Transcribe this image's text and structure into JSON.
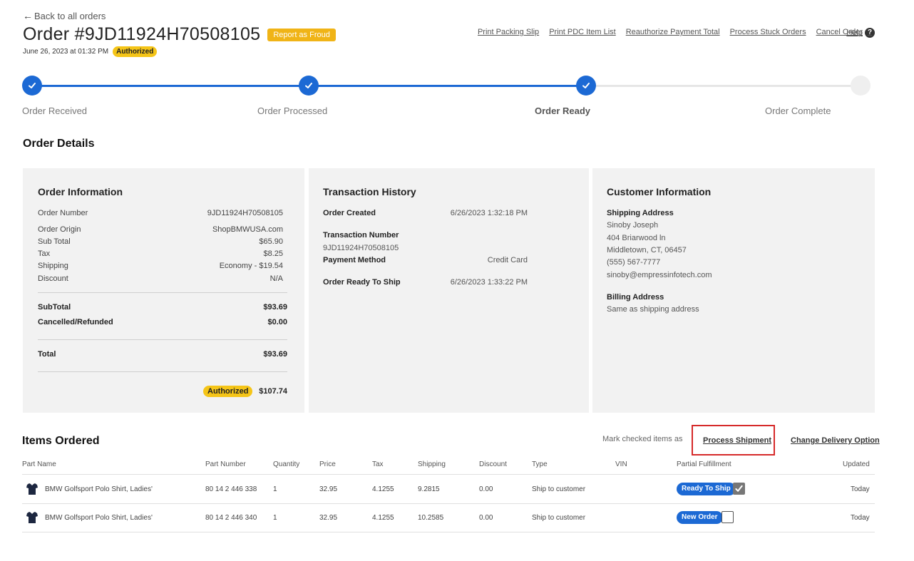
{
  "header": {
    "back_label": "Back to all orders",
    "order_title": "Order #9JD11924H70508105",
    "fraud_button": "Report as Froud",
    "date": "June 26, 2023 at 01:32 PM",
    "status_badge": "Authorized"
  },
  "actions": [
    "Print Packing Slip",
    "Print PDC Item List",
    "Reauthorize Payment Total",
    "Process Stuck Orders",
    "Cancel Order"
  ],
  "help_label": "Help",
  "progress": {
    "steps": [
      {
        "label": "Order Received",
        "state": "done"
      },
      {
        "label": "Order Processed",
        "state": "done"
      },
      {
        "label": "Order Ready",
        "state": "current"
      },
      {
        "label": "Order Complete",
        "state": "todo"
      }
    ]
  },
  "order_details_title": "Order Details",
  "order_info": {
    "title": "Order Information",
    "rows": [
      {
        "label": "Order Number",
        "value": "9JD11924H70508105"
      },
      {
        "label": "Order Origin",
        "value": "ShopBMWUSA.com"
      },
      {
        "label": "Sub Total",
        "value": "$65.90"
      },
      {
        "label": "Tax",
        "value": "$8.25"
      },
      {
        "label": "Shipping",
        "value": "Economy - $19.54"
      },
      {
        "label": "Discount",
        "value": "N/A"
      }
    ],
    "subtotal_label": "SubTotal",
    "subtotal_value": "$93.69",
    "cancelled_label": "Cancelled/Refunded",
    "cancelled_value": "$0.00",
    "total_label": "Total",
    "total_value": "$93.69",
    "authorized_badge": "Authorized",
    "authorized_value": "$107.74"
  },
  "transaction": {
    "title": "Transaction History",
    "created_label": "Order Created",
    "created_value": "6/26/2023 1:32:18 PM",
    "txn_label": "Transaction Number",
    "txn_value": "9JD11924H70508105",
    "payment_label": "Payment Method",
    "payment_value": "Credit Card",
    "ready_label": "Order Ready To Ship",
    "ready_value": "6/26/2023 1:33:22 PM"
  },
  "customer": {
    "title": "Customer Information",
    "shipping_label": "Shipping Address",
    "name": "Sinoby Joseph",
    "street": "404 Briarwood ln",
    "city": "Middletown, CT, 06457",
    "phone": "(555) 567-7777",
    "email": "sinoby@empressinfotech.com",
    "billing_label": "Billing Address",
    "billing_value": "Same as shipping address"
  },
  "items": {
    "title": "Items Ordered",
    "mark_label": "Mark checked items as",
    "process_shipment": "Process Shipment",
    "change_delivery": "Change Delivery Option",
    "columns": [
      "Part Name",
      "Part Number",
      "Quantity",
      "Price",
      "Tax",
      "Shipping",
      "Discount",
      "Type",
      "VIN",
      "Partial Fulfillment",
      "Updated"
    ],
    "rows": [
      {
        "name": "BMW Golfsport Polo Shirt, Ladies'",
        "part": "80 14 2 446 338",
        "qty": "1",
        "price": "32.95",
        "tax": "4.1255",
        "shipping": "9.2815",
        "discount": "0.00",
        "type": "Ship to customer",
        "vin": "",
        "status": "Ready To Ship",
        "checked": true,
        "updated": "Today"
      },
      {
        "name": "BMW Golfsport Polo Shirt, Ladies'",
        "part": "80 14 2 446 340",
        "qty": "1",
        "price": "32.95",
        "tax": "4.1255",
        "shipping": "10.2585",
        "discount": "0.00",
        "type": "Ship to customer",
        "vin": "",
        "status": "New Order",
        "checked": false,
        "updated": "Today"
      }
    ]
  },
  "colors": {
    "accent": "#1c69d4",
    "badge": "#f5c518",
    "fraud": "#f0b417",
    "highlight": "#d62a2a"
  }
}
